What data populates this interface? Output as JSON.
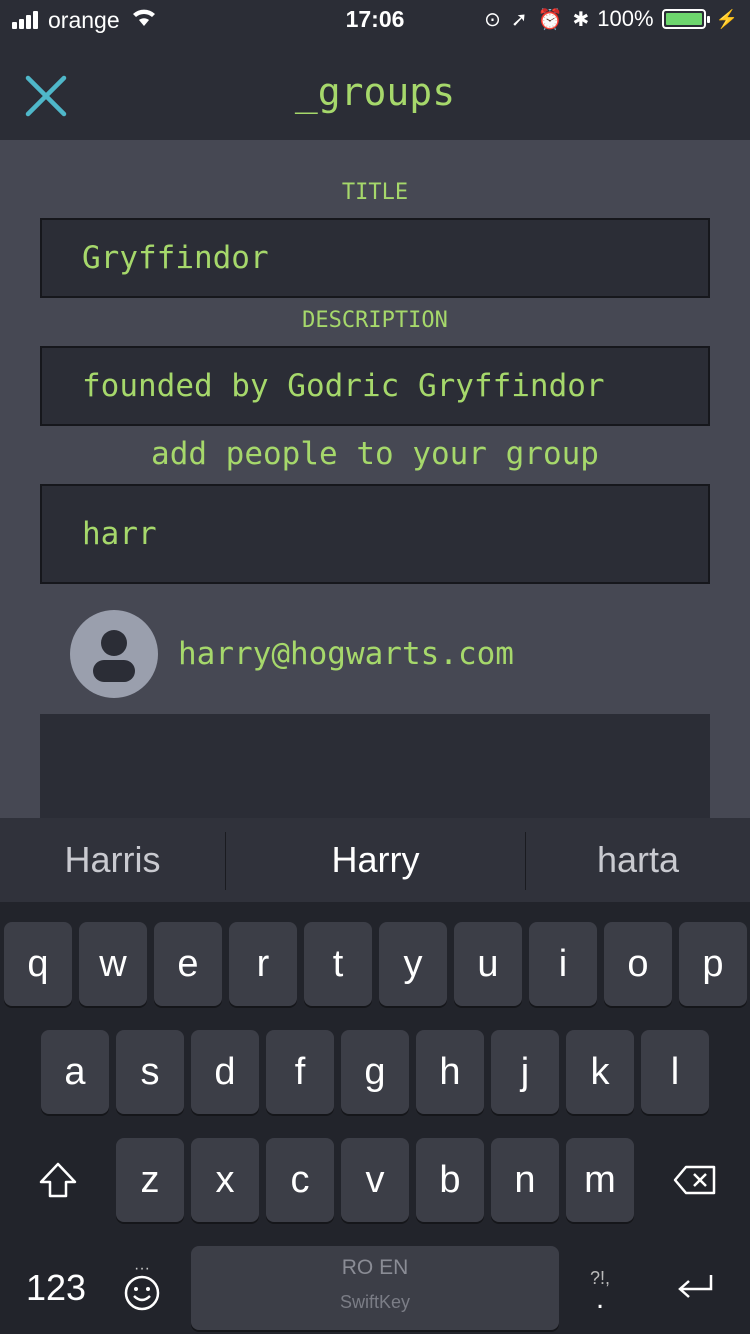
{
  "status_bar": {
    "carrier": "orange",
    "time": "17:06",
    "battery": "100%",
    "battery_level": 1.0
  },
  "nav": {
    "title": "_groups",
    "close_icon": "close-icon"
  },
  "form": {
    "title_label": "TITLE",
    "title_value": "Gryffindor",
    "description_label": "DESCRIPTION",
    "description_value": "founded by Godric Gryffindor",
    "add_people_label": "add people to your group",
    "search_value": "harr"
  },
  "results": [
    {
      "email": "harry@hogwarts.com",
      "icon": "user-avatar-icon"
    }
  ],
  "keyboard": {
    "suggestions": [
      "Harris",
      "Harry",
      "harta"
    ],
    "row1": [
      "q",
      "w",
      "e",
      "r",
      "t",
      "y",
      "u",
      "i",
      "o",
      "p"
    ],
    "row2": [
      "a",
      "s",
      "d",
      "f",
      "g",
      "h",
      "j",
      "k",
      "l"
    ],
    "row3": [
      "z",
      "x",
      "c",
      "v",
      "b",
      "n",
      "m"
    ],
    "numbers_label": "123",
    "space_language": "RO EN",
    "space_brand": "SwiftKey",
    "punct_label": "?!,",
    "punct_dot": ".",
    "colors": {
      "accent": "#a6d86b",
      "close": "#4fb7c9"
    }
  }
}
